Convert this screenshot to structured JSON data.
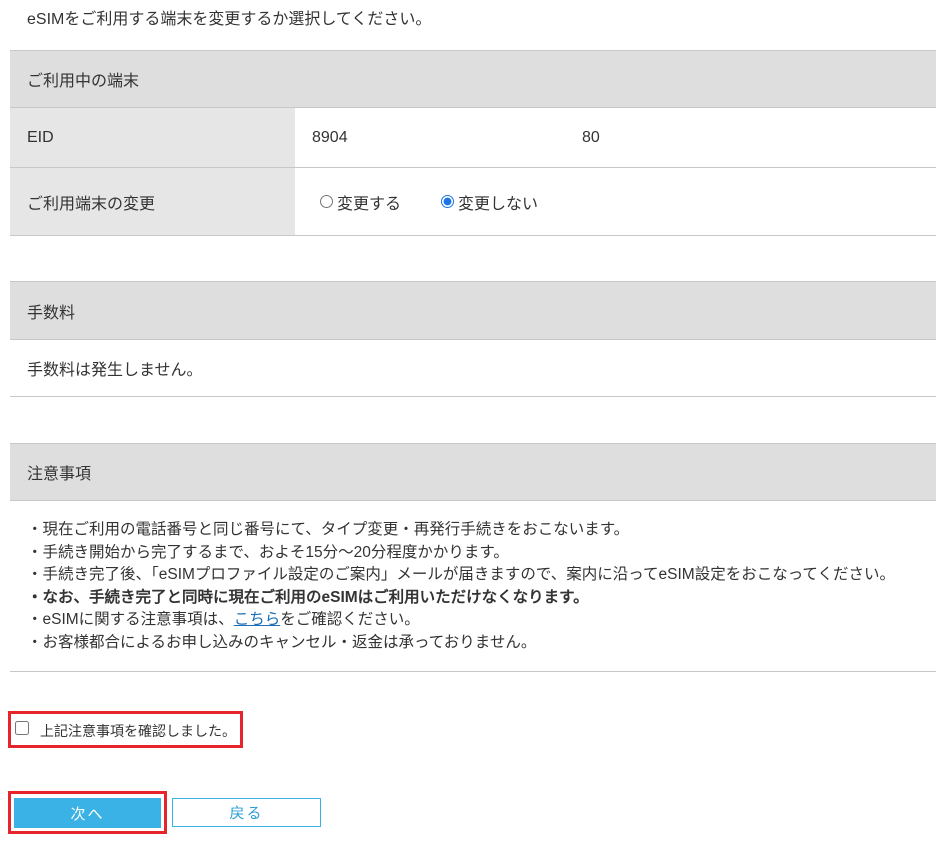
{
  "page": {
    "instruction": "eSIMをご利用する端末を変更するか選択してください。"
  },
  "device_section": {
    "title": "ご利用中の端末",
    "eid": {
      "label": "EID",
      "value_start": "8904",
      "value_end": "80"
    },
    "change": {
      "label": "ご利用端末の変更",
      "options": [
        {
          "label": "変更する",
          "checked": false
        },
        {
          "label": "変更しない",
          "checked": true
        }
      ]
    }
  },
  "fee_section": {
    "title": "手数料",
    "text": "手数料は発生しません。"
  },
  "notes_section": {
    "title": "注意事項",
    "items": [
      {
        "text": "・現在ご利用の電話番号と同じ番号にて、タイプ変更・再発行手続きをおこないます。"
      },
      {
        "text": "・手続き開始から完了するまで、およそ15分～20分程度かかります。"
      },
      {
        "text": "・手続き完了後、「eSIMプロファイル設定のご案内」メールが届きますので、案内に沿ってeSIM設定をおこなってください。"
      },
      {
        "text": "・なお、手続き完了と同時に現在ご利用のeSIMはご利用いただけなくなります。"
      },
      {
        "before": "・eSIMに関する注意事項は、",
        "link": "こちら",
        "after": "をご確認ください。"
      },
      {
        "text": "・お客様都合によるお申し込みのキャンセル・返金は承っておりません。"
      }
    ]
  },
  "confirm": {
    "label": "上記注意事項を確認しました。",
    "checked": false
  },
  "buttons": {
    "next": "次へ",
    "back": "戻る"
  },
  "colors": {
    "accent": "#3ab2e6",
    "accent_text": "#2c9fd6",
    "highlight": "#e6242b",
    "header_bg": "#dedede",
    "label_bg": "#e6e6e6",
    "link": "#1a6fb8",
    "text": "#333333"
  }
}
